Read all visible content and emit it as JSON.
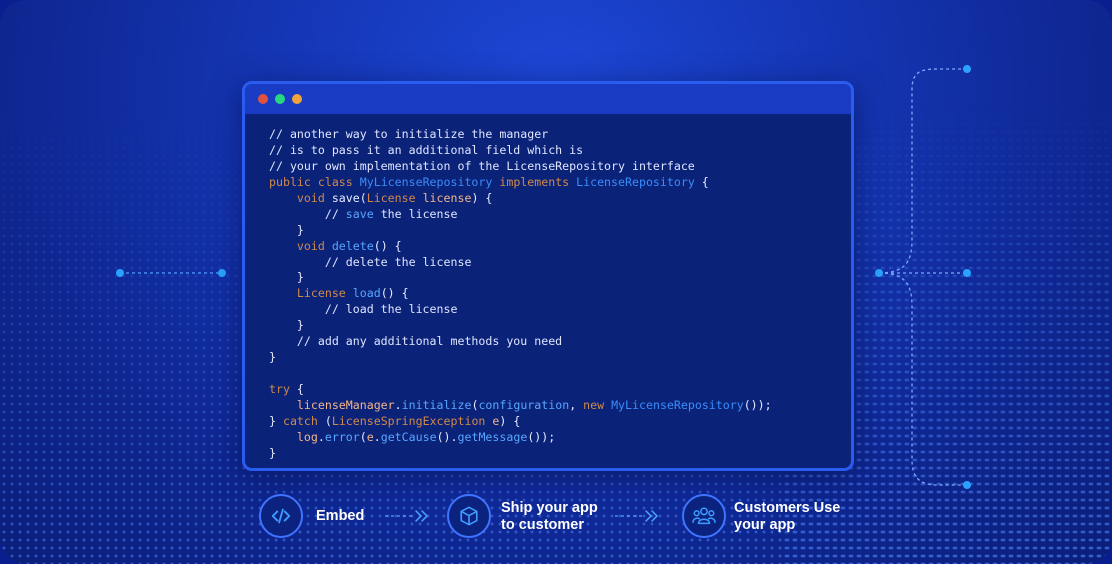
{
  "colors": {
    "background": "#1536b5",
    "window_bg": "#0a2278",
    "window_border": "#2a5cf0",
    "titlebar": "#1a3bc4",
    "traffic_red": "#e0523f",
    "traffic_green": "#27d77f",
    "traffic_orange": "#f0a33a",
    "keyword": "#d08a4c",
    "type": "#3a8dfb",
    "accent": "#29a3ff"
  },
  "code": {
    "lines": [
      [
        {
          "t": "// another way to initialize the manager",
          "c": "cm"
        }
      ],
      [
        {
          "t": "// is to pass it an additional field which is",
          "c": "cm"
        }
      ],
      [
        {
          "t": "// your own implementation of the LicenseRepository interface",
          "c": "cm"
        }
      ],
      [
        {
          "t": "public class ",
          "c": "kw"
        },
        {
          "t": "MyLicenseRepository ",
          "c": "type"
        },
        {
          "t": "implements ",
          "c": "kw"
        },
        {
          "t": "LicenseRepository",
          "c": "type"
        },
        {
          "t": " {",
          "c": "pl"
        }
      ],
      [
        {
          "t": "    ",
          "c": "pl"
        },
        {
          "t": "void ",
          "c": "kw"
        },
        {
          "t": "save(",
          "c": "pl"
        },
        {
          "t": "License ",
          "c": "kw"
        },
        {
          "t": "license",
          "c": "var"
        },
        {
          "t": ") {",
          "c": "pl"
        }
      ],
      [
        {
          "t": "        // ",
          "c": "cm"
        },
        {
          "t": "save ",
          "c": "fn"
        },
        {
          "t": "the license",
          "c": "cm"
        }
      ],
      [
        {
          "t": "    }",
          "c": "pl"
        }
      ],
      [
        {
          "t": "    ",
          "c": "pl"
        },
        {
          "t": "void ",
          "c": "kw"
        },
        {
          "t": "delete",
          "c": "fn"
        },
        {
          "t": "() {",
          "c": "pl"
        }
      ],
      [
        {
          "t": "        // delete the license",
          "c": "cm"
        }
      ],
      [
        {
          "t": "    }",
          "c": "pl"
        }
      ],
      [
        {
          "t": "    ",
          "c": "pl"
        },
        {
          "t": "License ",
          "c": "kw"
        },
        {
          "t": "load",
          "c": "fn"
        },
        {
          "t": "() {",
          "c": "pl"
        }
      ],
      [
        {
          "t": "        // load the license",
          "c": "cm"
        }
      ],
      [
        {
          "t": "    }",
          "c": "pl"
        }
      ],
      [
        {
          "t": "    // add any additional methods you need",
          "c": "cm"
        }
      ],
      [
        {
          "t": "}",
          "c": "pl"
        }
      ],
      [
        {
          "t": "",
          "c": "pl"
        }
      ],
      [
        {
          "t": "try",
          "c": "kw"
        },
        {
          "t": " {",
          "c": "pl"
        }
      ],
      [
        {
          "t": "    ",
          "c": "pl"
        },
        {
          "t": "licenseManager",
          "c": "var"
        },
        {
          "t": ".",
          "c": "pl"
        },
        {
          "t": "initialize",
          "c": "fn"
        },
        {
          "t": "(",
          "c": "pl"
        },
        {
          "t": "configuration",
          "c": "fn"
        },
        {
          "t": ", ",
          "c": "pl"
        },
        {
          "t": "new ",
          "c": "kw"
        },
        {
          "t": "MyLicenseRepository",
          "c": "type"
        },
        {
          "t": "());",
          "c": "pl"
        }
      ],
      [
        {
          "t": "} ",
          "c": "pl"
        },
        {
          "t": "catch",
          "c": "kw"
        },
        {
          "t": " (",
          "c": "pl"
        },
        {
          "t": "LicenseSpringException ",
          "c": "kw"
        },
        {
          "t": "e",
          "c": "var"
        },
        {
          "t": ") {",
          "c": "pl"
        }
      ],
      [
        {
          "t": "    ",
          "c": "pl"
        },
        {
          "t": "log",
          "c": "var"
        },
        {
          "t": ".",
          "c": "pl"
        },
        {
          "t": "error",
          "c": "fn"
        },
        {
          "t": "(",
          "c": "pl"
        },
        {
          "t": "e",
          "c": "var"
        },
        {
          "t": ".",
          "c": "pl"
        },
        {
          "t": "getCause",
          "c": "fn"
        },
        {
          "t": "().",
          "c": "pl"
        },
        {
          "t": "getMessage",
          "c": "fn"
        },
        {
          "t": "());",
          "c": "pl"
        }
      ],
      [
        {
          "t": "}",
          "c": "pl"
        }
      ]
    ]
  },
  "steps": [
    {
      "label": "Embed",
      "icon": "code-icon"
    },
    {
      "label": "Ship your app\nto customer",
      "icon": "cube-icon"
    },
    {
      "label": "Customers Use\nyour app",
      "icon": "users-icon"
    }
  ]
}
